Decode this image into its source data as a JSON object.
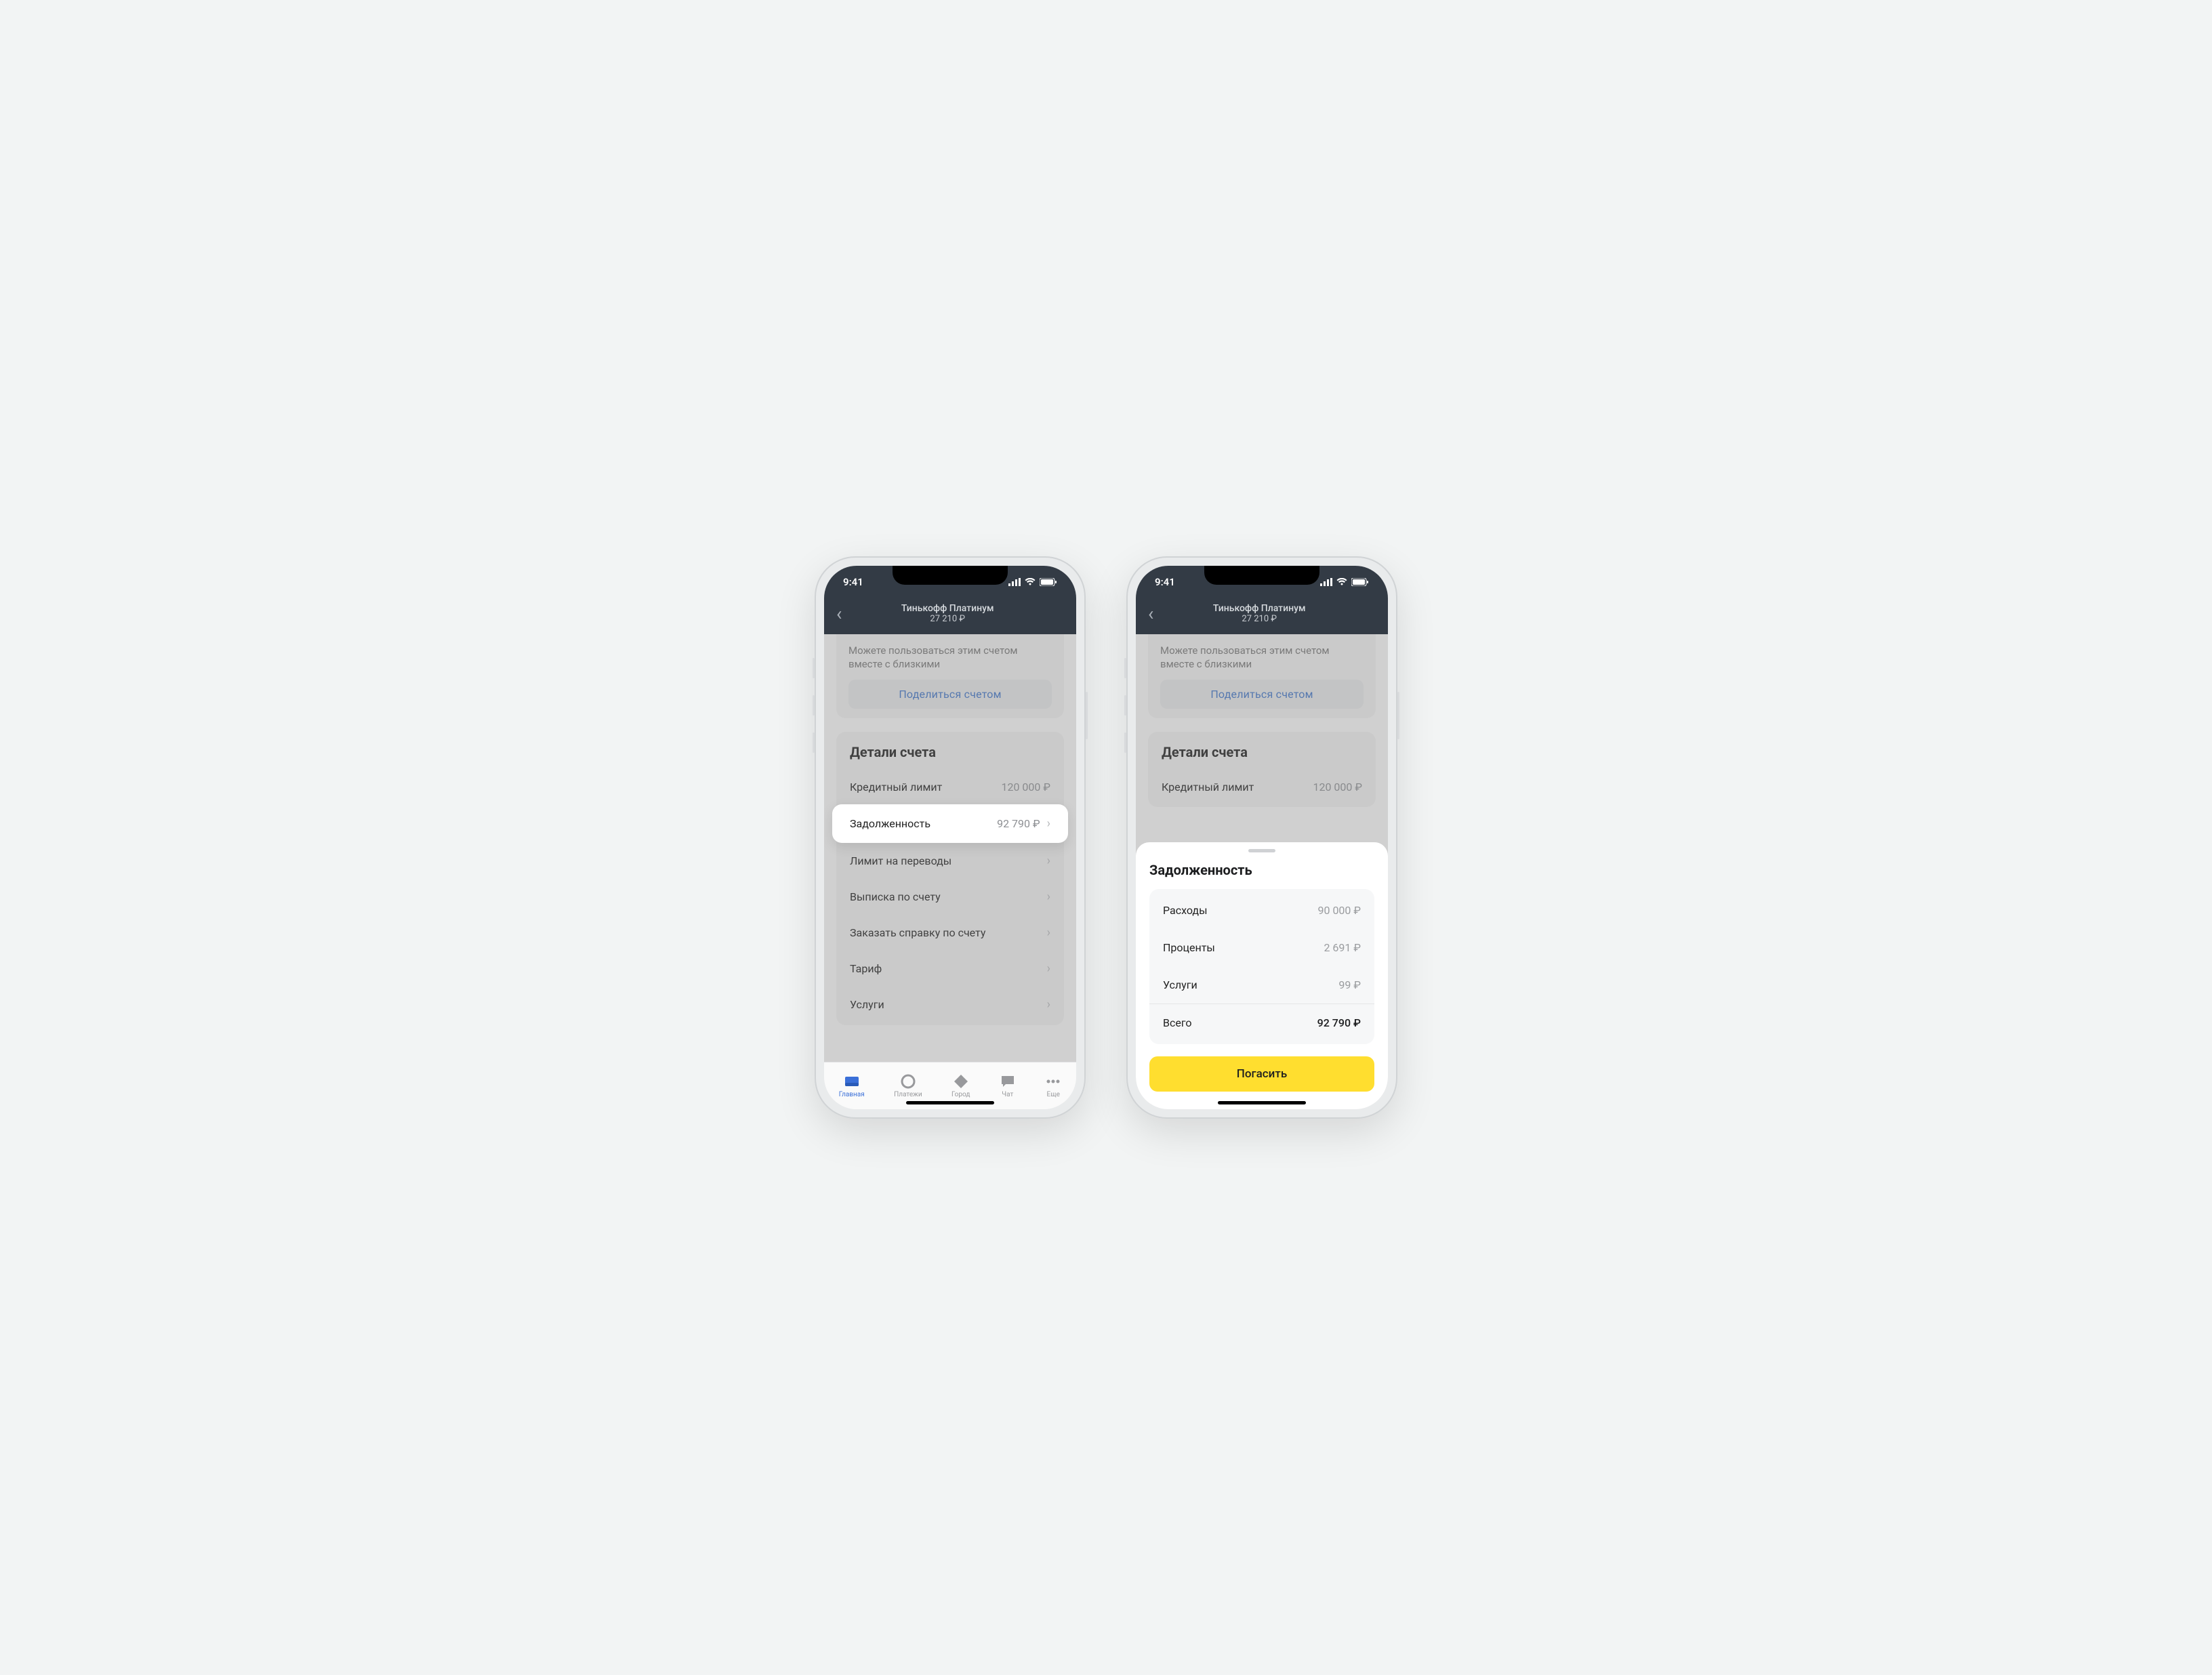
{
  "status": {
    "time": "9:41"
  },
  "header": {
    "title": "Тинькофф Платинум",
    "balance": "27 210 ₽"
  },
  "share": {
    "text": "Можете пользоваться этим счетом вместе с близкими",
    "button": "Поделиться счетом"
  },
  "details": {
    "title": "Детали счета",
    "credit_limit_label": "Кредитный лимит",
    "credit_limit_value": "120 000 ₽",
    "debt_label": "Задолженность",
    "debt_value": "92 790 ₽",
    "transfer_limit_label": "Лимит на переводы",
    "statement_label": "Выписка по счету",
    "order_cert_label": "Заказать справку по счету",
    "tariff_label": "Тариф",
    "services_label": "Услуги"
  },
  "tabs": {
    "home": "Главная",
    "payments": "Платежи",
    "city": "Город",
    "chat": "Чат",
    "more": "Еще"
  },
  "sheet": {
    "title": "Задолженность",
    "expenses_label": "Расходы",
    "expenses_value": "90 000 ₽",
    "interest_label": "Проценты",
    "interest_value": "2 691 ₽",
    "services_label": "Услуги",
    "services_value": "99 ₽",
    "total_label": "Всего",
    "total_value": "92 790 ₽",
    "pay_button": "Погасить"
  }
}
